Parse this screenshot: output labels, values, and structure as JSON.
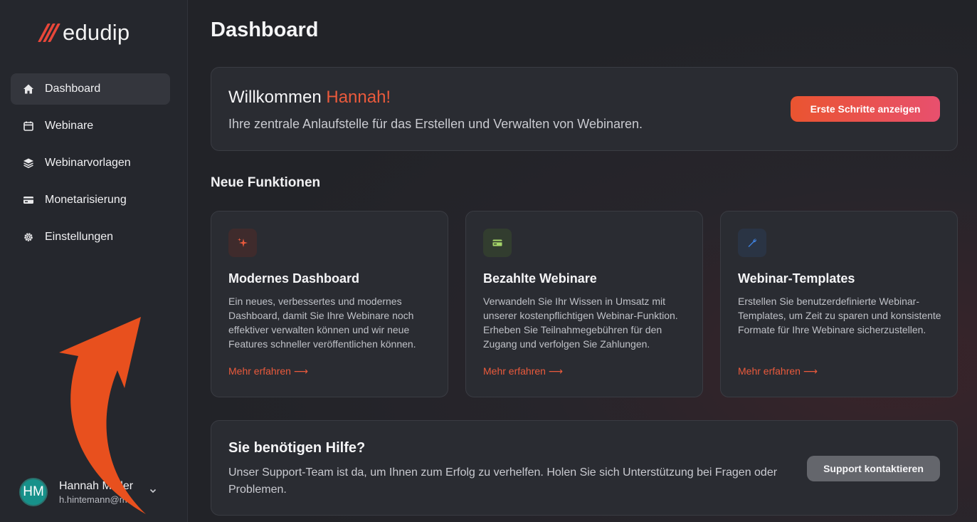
{
  "brand": {
    "name": "edudip",
    "accent": "#e8473a"
  },
  "sidebar": {
    "items": [
      {
        "label": "Dashboard",
        "icon": "home-icon",
        "active": true
      },
      {
        "label": "Webinare",
        "icon": "calendar-icon"
      },
      {
        "label": "Webinarvorlagen",
        "icon": "layers-icon"
      },
      {
        "label": "Monetarisierung",
        "icon": "credit-card-icon"
      },
      {
        "label": "Einstellungen",
        "icon": "gear-icon"
      }
    ]
  },
  "user": {
    "initials": "HM",
    "name": "Hannah Müller",
    "email": "h.hintemann@m...",
    "avatar_color": "#17918a"
  },
  "main": {
    "title": "Dashboard",
    "welcome": {
      "greeting": "Willkommen",
      "name": "Hannah!",
      "text": "Ihre zentrale Anlaufstelle für das Erstellen und Verwalten von Webinaren.",
      "button": "Erste Schritte anzeigen"
    },
    "features_title": "Neue Funktionen",
    "features": [
      {
        "icon": "sparkles-icon",
        "title": "Modernes Dashboard",
        "description": "Ein neues, verbessertes und modernes Dashboard, damit Sie Ihre Webinare noch effektiver verwalten können und wir neue Features schneller veröffentlichen können.",
        "link": "Mehr erfahren ⟶"
      },
      {
        "icon": "credit-card-icon",
        "title": "Bezahlte Webinare",
        "description": "Verwandeln Sie Ihr Wissen in Umsatz mit unserer kostenpflichtigen Webinar-Funktion. Erheben Sie Teilnahmegebühren für den Zugang und verfolgen Sie Zahlungen.",
        "link": "Mehr erfahren ⟶"
      },
      {
        "icon": "wrench-icon",
        "title": "Webinar-Templates",
        "description": "Erstellen Sie benutzerdefinierte Webinar-Templates, um Zeit zu sparen und konsistente Formate für Ihre Webinare sicherzustellen.",
        "link": "Mehr erfahren ⟶"
      }
    ],
    "help": {
      "title": "Sie benötigen Hilfe?",
      "text": "Unser Support-Team ist da, um Ihnen zum Erfolg zu verhelfen. Holen Sie sich Unterstützung bei Fragen oder Problemen.",
      "button": "Support kontaktieren"
    }
  },
  "colors": {
    "accent": "#ea5a3c",
    "arrow": "#e8501e"
  }
}
